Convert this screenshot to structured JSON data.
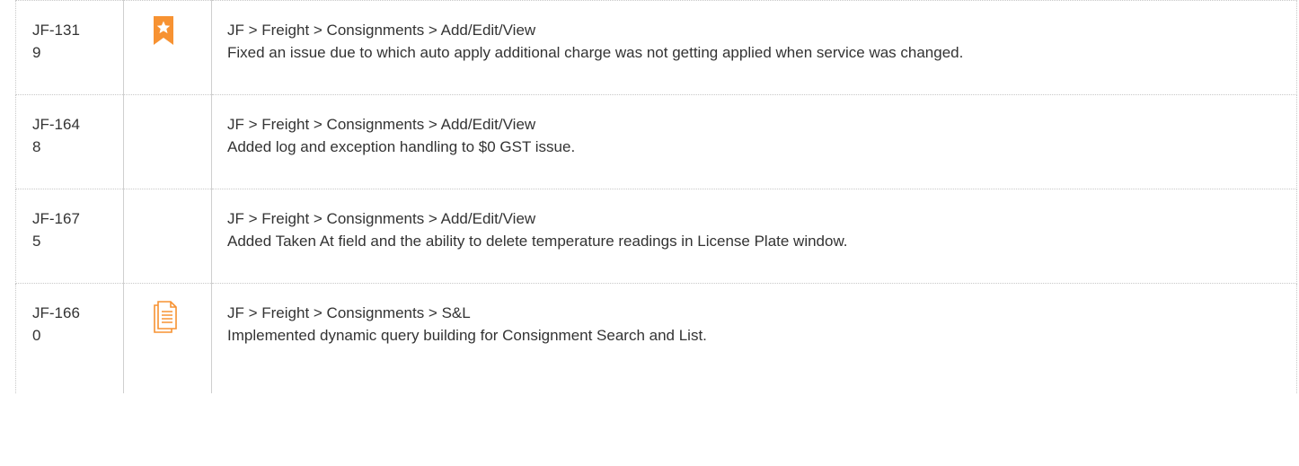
{
  "colors": {
    "star_badge": "#f79232",
    "document_icon": "#f79232",
    "border": "#c8c8c8",
    "text": "#333333"
  },
  "rows": [
    {
      "id": "JF-1319",
      "icon": "star-bookmark-icon",
      "path": "JF > Freight > Consignments > Add/Edit/View",
      "description": "Fixed an issue due to which auto apply additional charge was not getting applied when service was changed."
    },
    {
      "id": "JF-1648",
      "icon": "",
      "path": "JF > Freight > Consignments > Add/Edit/View",
      "description": "Added log and exception handling to $0 GST issue."
    },
    {
      "id": "JF-1675",
      "icon": "",
      "path": "JF > Freight > Consignments > Add/Edit/View",
      "description": "Added Taken At field and the ability to delete temperature readings in License Plate window."
    },
    {
      "id": "JF-1660",
      "icon": "document-icon",
      "path": "JF > Freight > Consignments > S&L",
      "description": "Implemented dynamic query building for Consignment Search and List."
    }
  ]
}
